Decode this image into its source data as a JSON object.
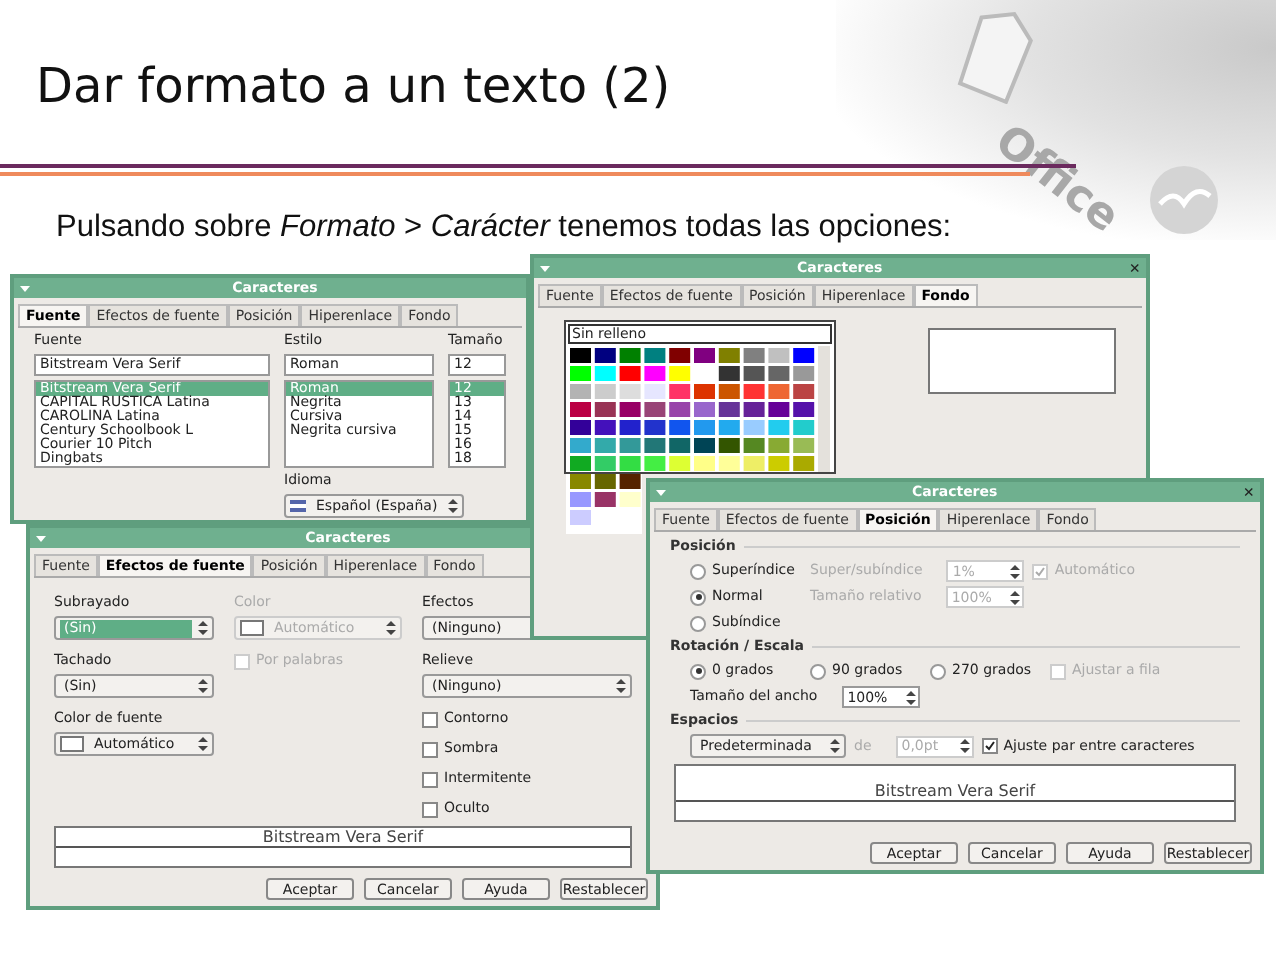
{
  "slide": {
    "title": "Dar formato a un texto (2)",
    "logo": "Office",
    "intro": "Pulsando sobre *Formato* > *Carácter* tenemos todas las opciones:"
  },
  "dialogs": [
    {
      "kind": "fuente",
      "title": "Caracteres",
      "tabs": [
        {
          "label": "Fuente",
          "selected": true
        },
        {
          "label": "Efectos de fuente",
          "selected": false
        },
        {
          "label": "Posición",
          "selected": false
        },
        {
          "label": "Hiperenlace",
          "selected": false
        },
        {
          "label": "Fondo",
          "selected": false
        }
      ],
      "columns": [
        {
          "label": "Fuente",
          "value": "Bitstream Vera Serif",
          "items": [
            {
              "label": "Bitstream Vera Serif",
              "selected": true
            },
            {
              "label": "CAPITAL RUSTICA Latina",
              "selected": false
            },
            {
              "label": "CAROLINA Latina",
              "selected": false
            },
            {
              "label": "Century Schoolbook L",
              "selected": false
            },
            {
              "label": "Courier 10 Pitch",
              "selected": false
            },
            {
              "label": "Dingbats",
              "selected": false
            }
          ]
        },
        {
          "label": "Estilo",
          "value": "Roman",
          "items": [
            {
              "label": "Roman",
              "selected": true
            },
            {
              "label": "Negrita",
              "selected": false
            },
            {
              "label": "Cursiva",
              "selected": false
            },
            {
              "label": "Negrita cursiva",
              "selected": false
            }
          ]
        },
        {
          "label": "Tamaño",
          "value": "12",
          "items": [
            {
              "label": "12",
              "selected": true
            },
            {
              "label": "13",
              "selected": false
            },
            {
              "label": "14",
              "selected": false
            },
            {
              "label": "15",
              "selected": false
            },
            {
              "label": "16",
              "selected": false
            },
            {
              "label": "18",
              "selected": false
            }
          ]
        }
      ],
      "language": {
        "label": "Idioma",
        "value": "Español (España)"
      }
    },
    {
      "kind": "efectos",
      "title": "Caracteres",
      "tabs": [
        {
          "label": "Fuente",
          "selected": false
        },
        {
          "label": "Efectos de fuente",
          "selected": true
        },
        {
          "label": "Posición",
          "selected": false
        },
        {
          "label": "Hiperenlace",
          "selected": false
        },
        {
          "label": "Fondo",
          "selected": false
        }
      ],
      "columns": [
        [
          {
            "kind": "select",
            "label": "Subrayado",
            "value": "(Sin)",
            "focused": true,
            "disabled": false
          },
          {
            "kind": "select",
            "label": "Tachado",
            "value": "(Sin)",
            "focused": false,
            "disabled": false
          },
          {
            "kind": "color-select",
            "label": "Color de fuente",
            "value": "Automático",
            "focused": false,
            "disabled": false
          }
        ],
        [
          {
            "kind": "color-select",
            "label": "Color",
            "value": "Automático",
            "focused": false,
            "disabled": true
          },
          {
            "kind": "checkbox",
            "label": "Por palabras",
            "checked": false,
            "disabled": true
          }
        ],
        [
          {
            "kind": "select",
            "label": "Efectos",
            "value": "(Ninguno)",
            "focused": false,
            "disabled": false
          },
          {
            "kind": "select",
            "label": "Relieve",
            "value": "(Ninguno)",
            "focused": false,
            "disabled": false
          },
          {
            "kind": "checkbox",
            "label": "Contorno",
            "checked": false,
            "disabled": false
          },
          {
            "kind": "checkbox",
            "label": "Sombra",
            "checked": false,
            "disabled": false
          },
          {
            "kind": "checkbox",
            "label": "Intermitente",
            "checked": false,
            "disabled": false
          },
          {
            "kind": "checkbox",
            "label": "Oculto",
            "checked": false,
            "disabled": false
          }
        ]
      ],
      "preview": "Bitstream Vera Serif",
      "buttons": [
        "Aceptar",
        "Cancelar",
        "Ayuda",
        "Restablecer"
      ]
    },
    {
      "kind": "fondo",
      "title": "Caracteres",
      "close": "×",
      "tabs": [
        {
          "label": "Fuente",
          "selected": false
        },
        {
          "label": "Efectos de fuente",
          "selected": false
        },
        {
          "label": "Posición",
          "selected": false
        },
        {
          "label": "Hiperenlace",
          "selected": false
        },
        {
          "label": "Fondo",
          "selected": true
        }
      ],
      "palette_header": "Sin relleno"
    },
    {
      "kind": "posicion",
      "title": "Caracteres",
      "close": "×",
      "tabs": [
        {
          "label": "Fuente",
          "selected": false
        },
        {
          "label": "Efectos de fuente",
          "selected": false
        },
        {
          "label": "Posición",
          "selected": true
        },
        {
          "label": "Hiperenlace",
          "selected": false
        },
        {
          "label": "Fondo",
          "selected": false
        }
      ],
      "sections": [
        {
          "title": "Posición",
          "rows": [
            {
              "items": [
                {
                  "kind": "radio",
                  "label": "Superíndice",
                  "selected": false
                },
                {
                  "kind": "label",
                  "label": "Super/subíndice",
                  "disabled": true
                },
                {
                  "kind": "spin",
                  "value": "1%",
                  "disabled": true
                },
                {
                  "kind": "checkbox",
                  "label": "Automático",
                  "checked": true,
                  "disabled": true
                }
              ]
            },
            {
              "items": [
                {
                  "kind": "radio",
                  "label": "Normal",
                  "selected": true
                },
                {
                  "kind": "label",
                  "label": "Tamaño relativo",
                  "disabled": true
                },
                {
                  "kind": "spin",
                  "value": "100%",
                  "disabled": true
                }
              ]
            },
            {
              "items": [
                {
                  "kind": "radio",
                  "label": "Subíndice",
                  "selected": false
                }
              ]
            }
          ]
        },
        {
          "title": "Rotación / Escala",
          "rows": [
            {
              "items": [
                {
                  "kind": "radio",
                  "label": "0 grados",
                  "selected": true
                },
                {
                  "kind": "radio",
                  "label": "90 grados",
                  "selected": false
                },
                {
                  "kind": "radio",
                  "label": "270 grados",
                  "selected": false
                },
                {
                  "kind": "checkbox",
                  "label": "Ajustar a fila",
                  "checked": false,
                  "disabled": true
                }
              ]
            },
            {
              "items": [
                {
                  "kind": "label",
                  "label": "Tamaño del ancho",
                  "disabled": false
                },
                {
                  "kind": "spin",
                  "value": "100%",
                  "disabled": false
                }
              ]
            }
          ]
        },
        {
          "title": "Espacios",
          "rows": [
            {
              "items": [
                {
                  "kind": "select",
                  "value": "Predeterminada",
                  "disabled": false
                },
                {
                  "kind": "label",
                  "label": "de",
                  "disabled": true
                },
                {
                  "kind": "spin",
                  "value": "0,0pt",
                  "disabled": true
                },
                {
                  "kind": "checkbox",
                  "label": "Ajuste par entre caracteres",
                  "checked": true,
                  "disabled": false
                }
              ]
            }
          ]
        }
      ],
      "preview": "Bitstream Vera Serif",
      "buttons": [
        "Aceptar",
        "Cancelar",
        "Ayuda",
        "Restablecer"
      ]
    }
  ]
}
